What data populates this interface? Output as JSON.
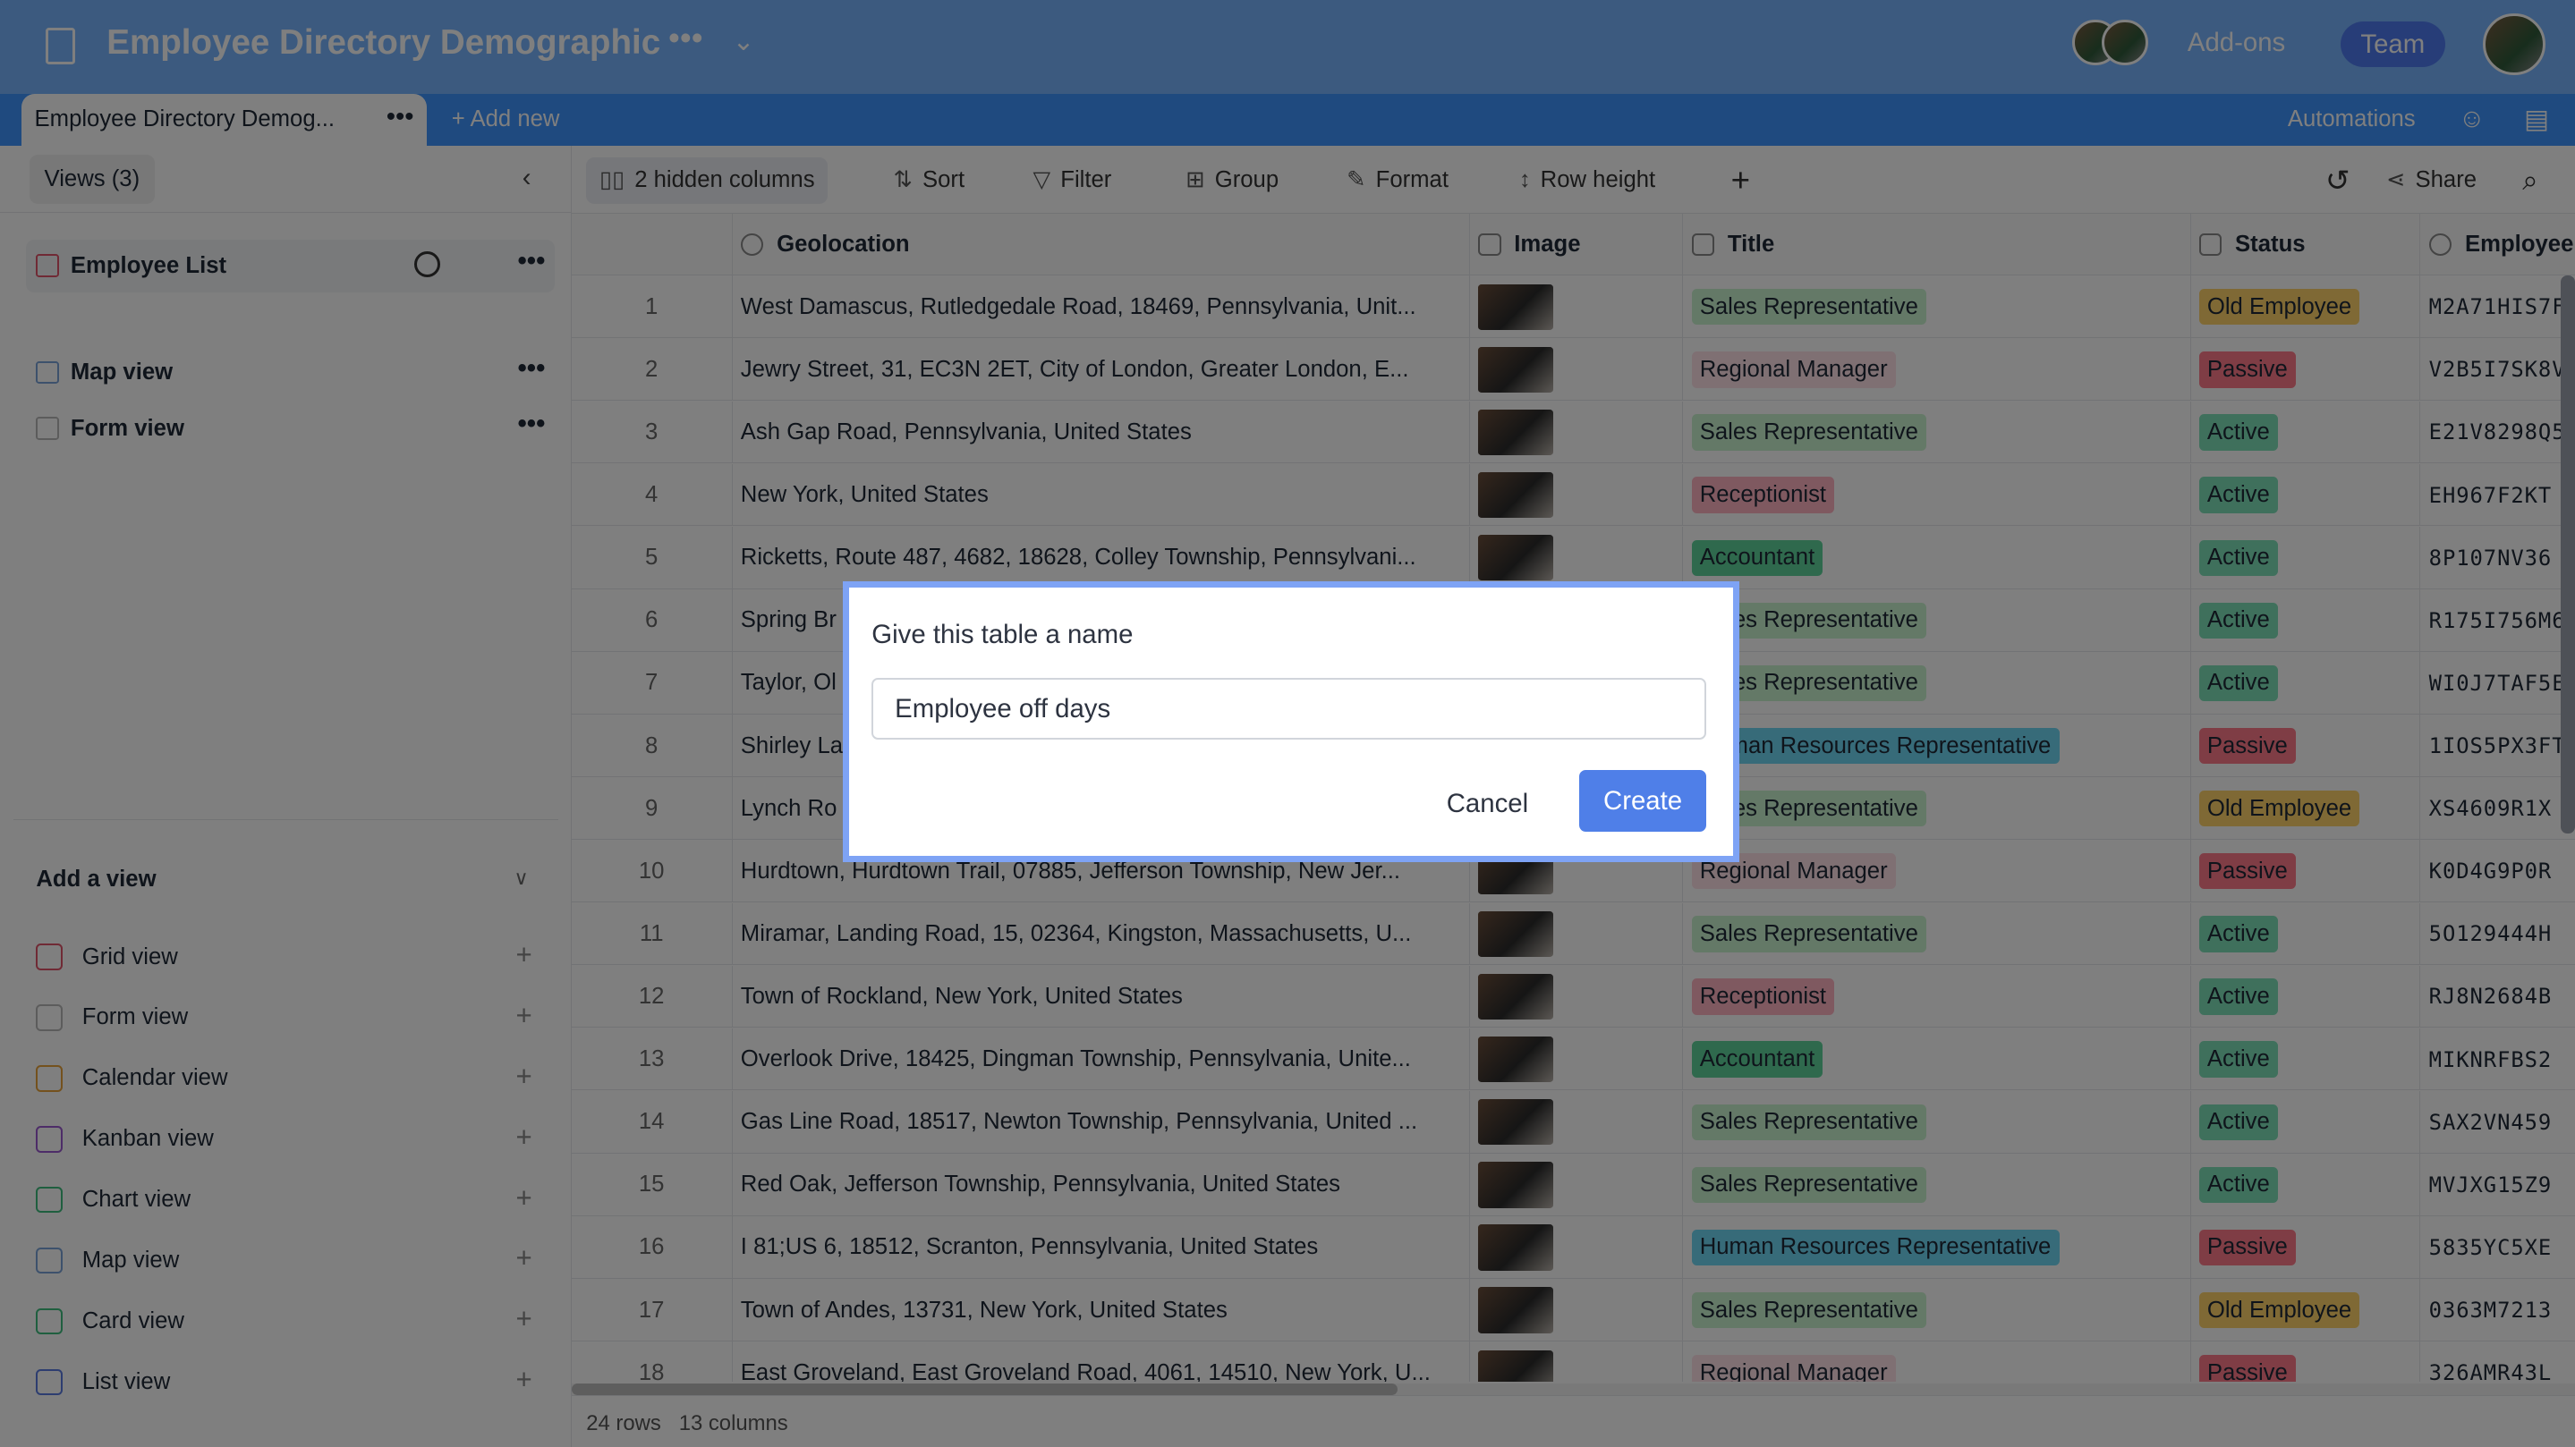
{
  "header": {
    "title": "Employee Directory Demographic",
    "addons": "Add-ons",
    "team": "Team"
  },
  "tabbar": {
    "active_tab": "Employee Directory Demog...",
    "add_new": "+ Add new",
    "automations": "Automations"
  },
  "sidebar": {
    "views_button": "Views (3)",
    "views": [
      {
        "label": "Employee List",
        "icon": "grid-icon"
      },
      {
        "label": "Map view",
        "icon": "map-icon"
      },
      {
        "label": "Form view",
        "icon": "form-icon"
      }
    ],
    "add_view_label": "Add a view",
    "view_types": [
      {
        "label": "Grid view",
        "color": "#e0556a"
      },
      {
        "label": "Form view",
        "color": "#b9b9b9"
      },
      {
        "label": "Calendar view",
        "color": "#e8a33a"
      },
      {
        "label": "Kanban view",
        "color": "#9b59d0"
      },
      {
        "label": "Chart view",
        "color": "#3fbf7f"
      },
      {
        "label": "Map view",
        "color": "#7aa3d8"
      },
      {
        "label": "Card view",
        "color": "#3fbf7f"
      },
      {
        "label": "List view",
        "color": "#5b7be0"
      }
    ]
  },
  "toolbar": {
    "hidden_columns": "2 hidden columns",
    "sort": "Sort",
    "filter": "Filter",
    "group": "Group",
    "format": "Format",
    "row_height": "Row height",
    "add": "+",
    "share": "Share"
  },
  "table": {
    "columns": [
      "Geolocation",
      "Image",
      "Title",
      "Status",
      "Employee"
    ],
    "rows": [
      [
        "1",
        "West Damascus, Rutledgedale Road, 18469, Pennsylvania, Unit...",
        "Sales Representative",
        "Old Employee",
        "M2A71HIS7F"
      ],
      [
        "2",
        "Jewry Street, 31, EC3N 2ET, City of London, Greater London, E...",
        "Regional Manager",
        "Passive",
        "V2B5I7SK8V"
      ],
      [
        "3",
        "Ash Gap Road, Pennsylvania, United States",
        "Sales Representative",
        "Active",
        "E21V8298Q5"
      ],
      [
        "4",
        "New York, United States",
        "Receptionist",
        "Active",
        "EH967F2KT"
      ],
      [
        "5",
        "Ricketts, Route 487, 4682, 18628, Colley Township, Pennsylvani...",
        "Accountant",
        "Active",
        "8P107NV36"
      ],
      [
        "6",
        "Spring Br",
        "Sales Representative",
        "Active",
        "R175I756M6"
      ],
      [
        "7",
        "Taylor, Ol",
        "Sales Representative",
        "Active",
        "WI0J7TAF5E"
      ],
      [
        "8",
        "Shirley La",
        "Human Resources Representative",
        "Passive",
        "1IOS5PX3FT"
      ],
      [
        "9",
        "Lynch Ro",
        "Sales Representative",
        "Old Employee",
        "XS4609R1X"
      ],
      [
        "10",
        "Hurdtown, Hurdtown Trail, 07885, Jefferson Township, New Jer...",
        "Regional Manager",
        "Passive",
        "K0D4G9P0R"
      ],
      [
        "11",
        "Miramar, Landing Road, 15, 02364, Kingston, Massachusetts, U...",
        "Sales Representative",
        "Active",
        "5O129444H"
      ],
      [
        "12",
        "Town of Rockland, New York, United States",
        "Receptionist",
        "Active",
        "RJ8N2684B"
      ],
      [
        "13",
        "Overlook Drive, 18425, Dingman Township, Pennsylvania, Unite...",
        "Accountant",
        "Active",
        "MIKNRFBS2"
      ],
      [
        "14",
        "Gas Line Road, 18517, Newton Township, Pennsylvania, United ...",
        "Sales Representative",
        "Active",
        "SAX2VN459"
      ],
      [
        "15",
        "Red Oak, Jefferson Township, Pennsylvania, United States",
        "Sales Representative",
        "Active",
        "MVJXG15Z9"
      ],
      [
        "16",
        "I 81;US 6, 18512, Scranton, Pennsylvania, United States",
        "Human Resources Representative",
        "Passive",
        "5835YC5XE"
      ],
      [
        "17",
        "Town of Andes, 13731, New York, United States",
        "Sales Representative",
        "Old Employee",
        "0363M7213"
      ],
      [
        "18",
        "East Groveland, East Groveland Road, 4061, 14510, New York, U...",
        "Regional Manager",
        "Passive",
        "326AMR43L"
      ]
    ]
  },
  "tag_colors": {
    "Sales Representative": "#c9f2cf",
    "Regional Manager": "#ffe0e6",
    "Receptionist": "#ffb3c1",
    "Accountant": "#5fd39a",
    "Human Resources Representative": "#6fd6f2",
    "Old Employee": "#ffd36b",
    "Passive": "#ff7a8a",
    "Active": "#7ee0b8"
  },
  "footer": {
    "rows": "24 rows",
    "columns": "13 columns"
  },
  "modal": {
    "title": "Give this table a name",
    "input_value": "Employee off days",
    "cancel": "Cancel",
    "create": "Create"
  }
}
